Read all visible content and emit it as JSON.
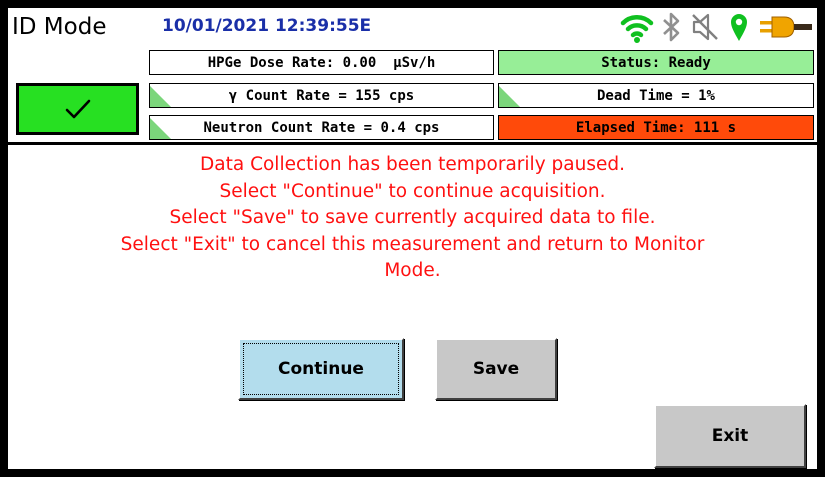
{
  "header": {
    "mode_title": "ID Mode",
    "datetime": "10/01/2021 12:39:55E",
    "icons": [
      "wifi-icon",
      "bluetooth-icon",
      "speaker-muted-icon",
      "location-pin-icon",
      "power-plug-icon"
    ]
  },
  "readings": {
    "dose_rate": "HPGe Dose Rate: 0.00  µSv/h",
    "gamma_rate": "γ Count Rate = 155 cps",
    "neutron_rate": "Neutron Count Rate = 0.4 cps",
    "status": "Status: Ready",
    "dead_time": "Dead Time = 1%",
    "elapsed_time": "Elapsed Time: 111 s"
  },
  "message": {
    "lines": [
      "Data Collection has been temporarily paused.",
      "Select \"Continue\" to continue acquisition.",
      "Select \"Save\" to save currently acquired data to file.",
      "Select \"Exit\" to cancel this measurement and return to Monitor",
      "Mode."
    ]
  },
  "buttons": {
    "continue_label": "Continue",
    "save_label": "Save",
    "exit_label": "Exit"
  },
  "colors": {
    "status_ready": "#97ee97",
    "elapsed": "#ff4a0a",
    "ok_button": "#27e022",
    "message_text": "#ff1010",
    "datetime_text": "#1a2fa8"
  }
}
